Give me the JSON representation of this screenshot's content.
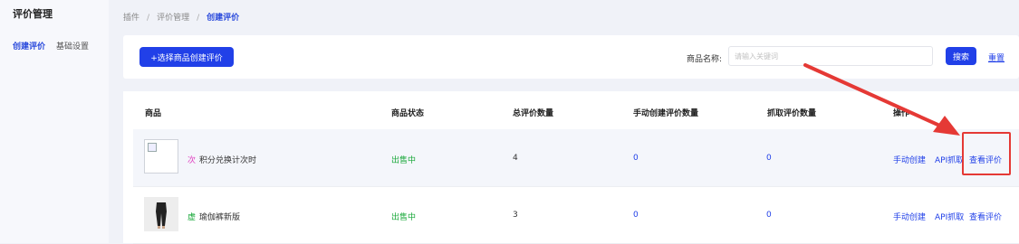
{
  "sidebar": {
    "title": "评价管理",
    "items": [
      {
        "label": "创建评价",
        "active": true
      },
      {
        "label": "基础设置",
        "active": false
      }
    ]
  },
  "breadcrumb": {
    "items": [
      "插件",
      "评价管理",
      "创建评价"
    ],
    "separator": "/"
  },
  "toolbar": {
    "create_label": "+选择商品创建评价",
    "search_label": "商品名称:",
    "search_placeholder": "请输入关键词",
    "search_value": "",
    "search_button": "搜索",
    "reset_link": "重置"
  },
  "table": {
    "headers": [
      "商品",
      "商品状态",
      "总评价数量",
      "手动创建评价数量",
      "抓取评价数量",
      "操作"
    ],
    "rows": [
      {
        "tag": "次",
        "tag_color": "#e040c0",
        "name": "积分兑换计次时",
        "status": "出售中",
        "total": "4",
        "manual": "0",
        "crawled": "0",
        "thumb": "broken-image-icon",
        "ops": [
          "手动创建",
          "API抓取",
          "查看评价"
        ]
      },
      {
        "tag": "虚",
        "tag_color": "#19a83a",
        "name": "瑜伽裤新版",
        "status": "出售中",
        "total": "3",
        "manual": "0",
        "crawled": "0",
        "thumb": "product-photo",
        "ops": [
          "手动创建",
          "API抓取",
          "查看评价"
        ]
      }
    ]
  },
  "colors": {
    "primary": "#2140e8",
    "status_green": "#19a83a",
    "annotation_red": "#e53935"
  }
}
